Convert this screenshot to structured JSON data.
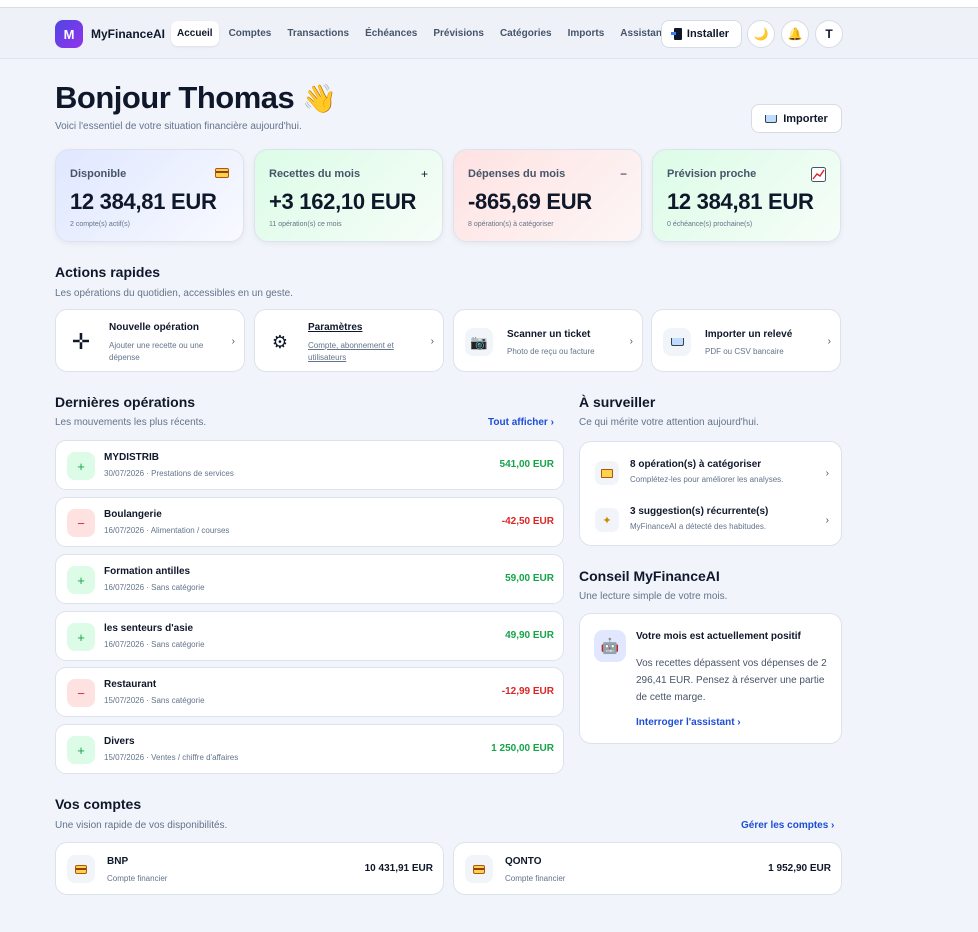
{
  "nav": {
    "logo_letter": "M",
    "brand": "MyFinanceAI",
    "items": [
      "Accueil",
      "Comptes",
      "Transactions",
      "Échéances",
      "Prévisions",
      "Catégories",
      "Imports",
      "Assistant IA"
    ],
    "install_label": "Installer",
    "avatar_letter": "T"
  },
  "header": {
    "greeting": "Bonjour Thomas",
    "greeting_emoji": "👋",
    "subtitle": "Voici l'essentiel de votre situation financière aujourd'hui.",
    "import_label": "Importer"
  },
  "stats": [
    {
      "label": "Disponible",
      "value": "12 384,81 EUR",
      "caption": "2 compte(s) actif(s)",
      "icon": "credit-card-icon"
    },
    {
      "label": "Recettes du mois",
      "value": "+3 162,10 EUR",
      "caption": "11 opération(s) ce mois",
      "icon": "plus-icon"
    },
    {
      "label": "Dépenses du mois",
      "value": "-865,69 EUR",
      "caption": "8 opération(s) à catégoriser",
      "icon": "minus-icon"
    },
    {
      "label": "Prévision proche",
      "value": "12 384,81 EUR",
      "caption": "0 échéance(s) prochaine(s)",
      "icon": "trend-chart-icon"
    }
  ],
  "quick": {
    "title": "Actions rapides",
    "subtitle": "Les opérations du quotidien, accessibles en un geste.",
    "items": [
      {
        "title": "Nouvelle opération",
        "desc": "Ajouter une recette ou une dépense",
        "icon": "cross-plus-icon"
      },
      {
        "title": "Paramètres",
        "desc": "Compte, abonnement et utilisateurs",
        "icon": "gear-icon"
      },
      {
        "title": "Scanner un ticket",
        "desc": "Photo de reçu ou facture",
        "icon": "camera-icon"
      },
      {
        "title": "Importer un relevé",
        "desc": "PDF ou CSV bancaire",
        "icon": "inbox-tray-icon"
      }
    ]
  },
  "ops": {
    "title": "Dernières opérations",
    "subtitle": "Les mouvements les plus récents.",
    "link": "Tout afficher ›",
    "items": [
      {
        "name": "MYDISTRIB",
        "detail": "30/07/2026 · Prestations de services",
        "amount": "541,00 EUR",
        "kind": "pos",
        "sign": "+"
      },
      {
        "name": "Boulangerie",
        "detail": "16/07/2026 · Alimentation / courses",
        "amount": "-42,50 EUR",
        "kind": "neg",
        "sign": "−"
      },
      {
        "name": "Formation antilles",
        "detail": "16/07/2026 · Sans catégorie",
        "amount": "59,00 EUR",
        "kind": "pos",
        "sign": "+"
      },
      {
        "name": "les senteurs d'asie",
        "detail": "16/07/2026 · Sans catégorie",
        "amount": "49,90 EUR",
        "kind": "pos",
        "sign": "+"
      },
      {
        "name": "Restaurant",
        "detail": "15/07/2026 · Sans catégorie",
        "amount": "-12,99 EUR",
        "kind": "neg",
        "sign": "−"
      },
      {
        "name": "Divers",
        "detail": "15/07/2026 · Ventes / chiffre d'affaires",
        "amount": "1 250,00 EUR",
        "kind": "pos",
        "sign": "+"
      }
    ]
  },
  "watch": {
    "title": "À surveiller",
    "subtitle": "Ce qui mérite votre attention aujourd'hui.",
    "items": [
      {
        "title": "8 opération(s) à catégoriser",
        "desc": "Complétez-les pour améliorer les analyses.",
        "icon": "folder-icon"
      },
      {
        "title": "3 suggestion(s) récurrente(s)",
        "desc": "MyFinanceAI a détecté des habitudes.",
        "icon": "sparkle-icon"
      }
    ]
  },
  "advice": {
    "title": "Conseil MyFinanceAI",
    "subtitle": "Une lecture simple de votre mois.",
    "card_title": "Votre mois est actuellement positif",
    "card_text": "Vos recettes dépassent vos dépenses de 2 296,41 EUR. Pensez à réserver une partie de cette marge.",
    "link": "Interroger l'assistant ›"
  },
  "accounts": {
    "title": "Vos comptes",
    "subtitle": "Une vision rapide de vos disponibilités.",
    "link": "Gérer les comptes ›",
    "items": [
      {
        "name": "BNP",
        "desc": "Compte financier",
        "value": "10 431,91 EUR"
      },
      {
        "name": "QONTO",
        "desc": "Compte financier",
        "value": "1 952,90 EUR"
      }
    ]
  }
}
